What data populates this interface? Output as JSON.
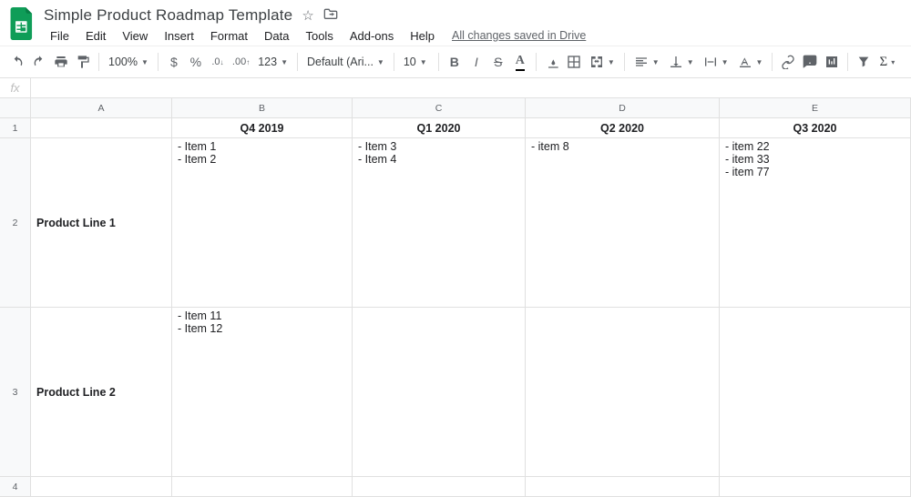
{
  "doc": {
    "title": "Simple Product Roadmap Template"
  },
  "menu": {
    "file": "File",
    "edit": "Edit",
    "view": "View",
    "insert": "Insert",
    "format": "Format",
    "data": "Data",
    "tools": "Tools",
    "addons": "Add-ons",
    "help": "Help",
    "save_status": "All changes saved in Drive"
  },
  "toolbar": {
    "zoom": "100%",
    "currency": "$",
    "percent": "%",
    "dec_dec": ".0",
    "inc_dec": ".00",
    "more_formats": "123",
    "font": "Default (Ari...",
    "font_size": "10"
  },
  "columns": {
    "A": "A",
    "B": "B",
    "C": "C",
    "D": "D",
    "E": "E"
  },
  "rows": {
    "1": "1",
    "2": "2",
    "3": "3",
    "4": "4"
  },
  "sheet": {
    "headers": {
      "b": "Q4 2019",
      "c": "Q1 2020",
      "d": "Q2 2020",
      "e": "Q3 2020"
    },
    "row2": {
      "label": "Product Line 1",
      "b": "- Item 1\n- Item 2",
      "c": "- Item 3\n- Item 4",
      "d": "- item 8",
      "e": "- item 22\n- item 33\n- item 77"
    },
    "row3": {
      "label": "Product Line 2",
      "b": "- Item 11\n- Item 12",
      "c": "",
      "d": "",
      "e": ""
    }
  }
}
